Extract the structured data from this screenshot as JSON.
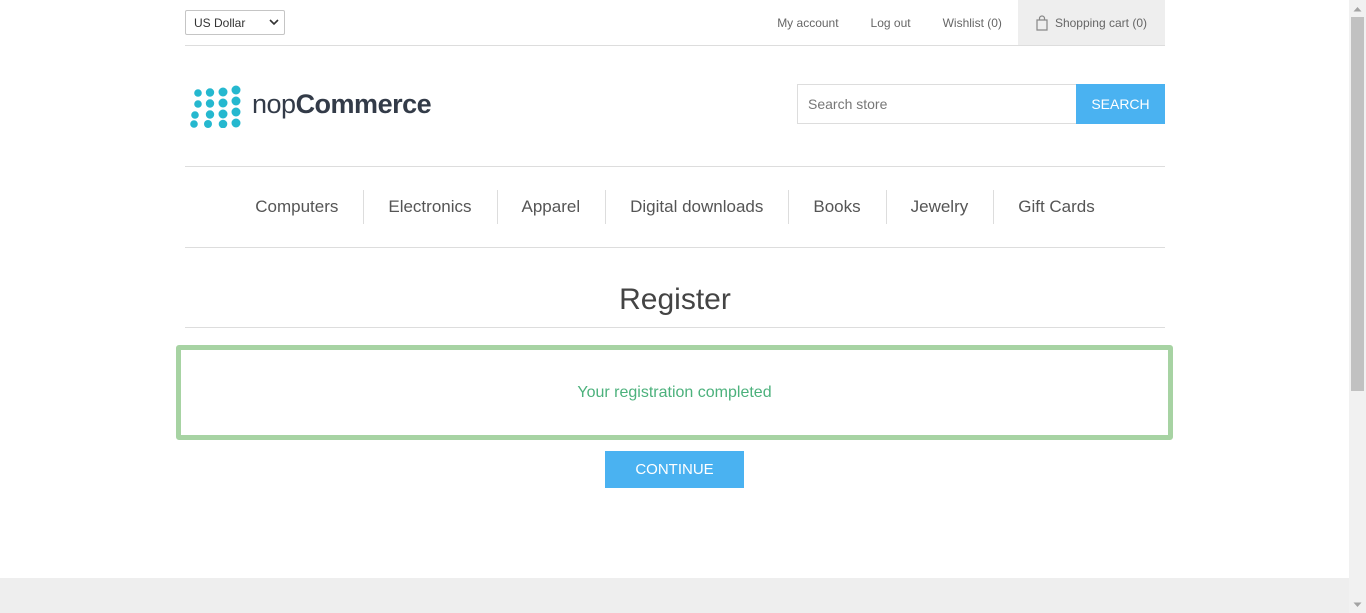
{
  "header": {
    "currency": {
      "selected": "US Dollar"
    },
    "links": {
      "my_account": "My account",
      "log_out": "Log out",
      "wishlist": "Wishlist (0)",
      "shopping_cart": "Shopping cart (0)"
    }
  },
  "logo": {
    "text_light": "nop",
    "text_bold": "Commerce",
    "color": "#25b8cf"
  },
  "search": {
    "placeholder": "Search store",
    "button_label": "Search"
  },
  "menu": {
    "items": [
      "Computers",
      "Electronics",
      "Apparel",
      "Digital downloads",
      "Books",
      "Jewelry",
      "Gift Cards"
    ]
  },
  "page": {
    "title": "Register",
    "result_message": "Your registration completed",
    "continue_label": "Continue"
  },
  "colors": {
    "accent": "#4ab2f1",
    "success_text": "#4cb17c",
    "success_border": "#a7d3a3"
  },
  "icons": {
    "cart": "shopping-bag-icon",
    "currency_dropdown": "chevron-down-icon"
  }
}
